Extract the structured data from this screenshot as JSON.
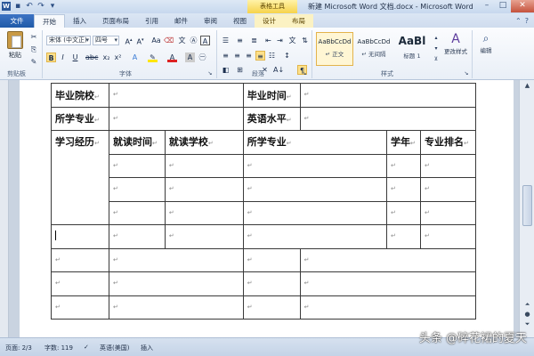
{
  "window": {
    "title": "新建 Microsoft Word 文档.docx - Microsoft Word",
    "context_tools": "表格工具"
  },
  "tabs": [
    {
      "label": "文件"
    },
    {
      "label": "开始"
    },
    {
      "label": "插入"
    },
    {
      "label": "页面布局"
    },
    {
      "label": "引用"
    },
    {
      "label": "邮件"
    },
    {
      "label": "审阅"
    },
    {
      "label": "视图"
    },
    {
      "label": "设计"
    },
    {
      "label": "布局"
    }
  ],
  "ribbon": {
    "clipboard": {
      "paste_label": "粘贴",
      "group_label": "剪贴板"
    },
    "font": {
      "font_name": "宋体 (中文正)",
      "font_size": "四号",
      "group_label": "字体"
    },
    "paragraph": {
      "group_label": "段落"
    },
    "styles": {
      "group_label": "样式",
      "items": [
        {
          "sample": "AaBbCcDd",
          "name": "↵ 正文"
        },
        {
          "sample": "AaBbCcDd",
          "name": "↵ 无间隔"
        },
        {
          "sample": "AaBl",
          "name": "标题 1"
        }
      ],
      "change_styles": "更改样式"
    },
    "editing": {
      "label": "编辑"
    }
  },
  "table": {
    "r1": {
      "label_a": "毕业院校",
      "label_b": "毕业时间"
    },
    "r2": {
      "label_a": "所学专业",
      "label_b": "英语水平"
    },
    "r3": {
      "label": "学习经历",
      "cols": [
        "就读时间",
        "就读学校",
        "所学专业",
        "学年",
        "专业排名"
      ]
    }
  },
  "status": {
    "page": "页面: 2/3",
    "words": "字数: 119",
    "language": "英语(美国)",
    "mode": "插入"
  },
  "watermark": "头条 @碎花裙的夏天",
  "colors": {
    "file_tab": "#1f5aa8",
    "context_tab": "#f6d34b",
    "ribbon_bg": "#e9eff7"
  }
}
